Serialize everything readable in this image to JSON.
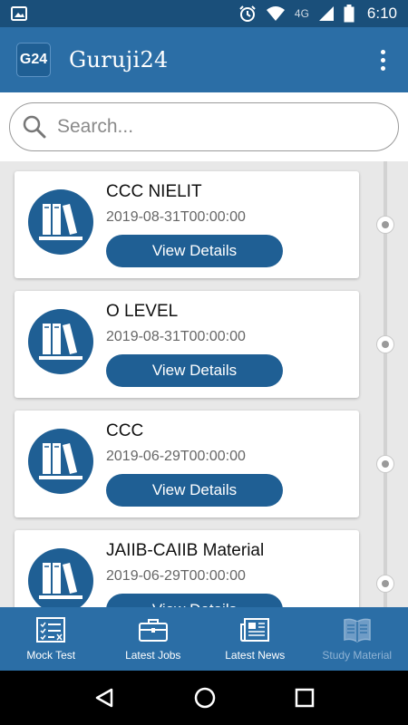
{
  "status_bar": {
    "time": "6:10",
    "network": "4G"
  },
  "app": {
    "logo_text": "G24",
    "title": "Guruji24"
  },
  "search": {
    "placeholder": "Search..."
  },
  "cards": [
    {
      "title": "CCC NIELIT",
      "date": "2019-08-31T00:00:00",
      "button": "View Details"
    },
    {
      "title": "O LEVEL",
      "date": "2019-08-31T00:00:00",
      "button": "View Details"
    },
    {
      "title": "CCC",
      "date": "2019-06-29T00:00:00",
      "button": "View Details"
    },
    {
      "title": "JAIIB-CAIIB Material",
      "date": "2019-06-29T00:00:00",
      "button": "View Details"
    }
  ],
  "bottom_nav": [
    {
      "label": "Mock Test",
      "icon": "checklist-icon",
      "active": false
    },
    {
      "label": "Latest Jobs",
      "icon": "briefcase-icon",
      "active": false
    },
    {
      "label": "Latest News",
      "icon": "newspaper-icon",
      "active": false
    },
    {
      "label": "Study Material",
      "icon": "book-icon",
      "active": true
    }
  ],
  "colors": {
    "primary": "#2b6ea6",
    "dark": "#1f5f94",
    "status_bar": "#1a4f7a"
  }
}
